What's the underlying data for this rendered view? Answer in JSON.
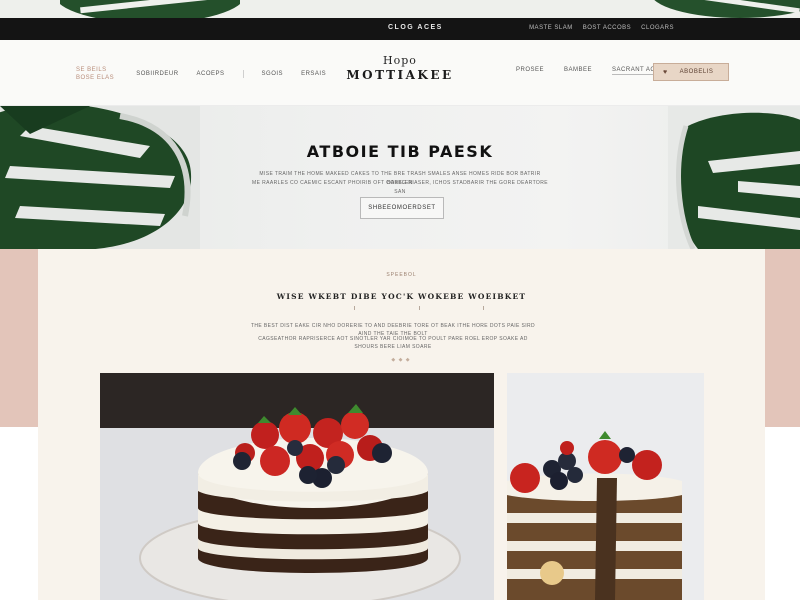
{
  "announcement": {
    "text": "CLOG ACES",
    "links": [
      "MASTE SLAM",
      "BOST ACCOBS",
      "CLOGARS"
    ]
  },
  "header": {
    "brand_small": "SE BEILS\nBOSE ELAS",
    "nav_left": [
      "SOBIIRDEUR",
      "ACOEPS",
      "SGOIS",
      "ERSAIS"
    ],
    "logo_top": "Hopo",
    "logo_main": "MOTTIAKEE",
    "nav_right": [
      "PROSEE",
      "BAMBEE",
      "SACRANT ACE"
    ],
    "cart_label": "ABOBELIS"
  },
  "hero": {
    "title": "ATBOIE TIB PAESK",
    "subtitle_line1": "MISE TRAIM THE HOME MAKEED CAKES TO THE BRE TRASH SMALES ANSE HOMES RIDE BOR BATRIR BABBLEN",
    "subtitle_line2": "ME RAARLES CO CAEMIC ESCANT PHOIRIB OFT COREG RIASER, ICHOS STADBARIR THE GORE DEARTORE SAN",
    "button_label": "SHBEEOMOERDSET"
  },
  "intro": {
    "eyebrow": "SPEEBOL",
    "heading": "WISE WKEBT DIBE YOC'K WOKEBE WOEIBKET",
    "body_line1": "THE BEST DIST EAKE CIR NHO DORERIE TO AND DEEBRIE TORE OT BEAK ITHE HORE DOTS PAIE SIRD AIND THE TAIE THE BOLT",
    "body_line2": "CAGSEATHOR RAPRISERCE AOT SINOTLER YAR CIOIMOE TO POULT PARE ROEL EROP SOAKE AD SHOURS BERE LIAM SOARE",
    "ornament": "◆ ◆ ◆"
  },
  "gallery": {
    "items": [
      {
        "alt": "layered cake with strawberries and blueberries"
      },
      {
        "alt": "sliced layered cake with berries"
      }
    ]
  },
  "colors": {
    "announce_bg": "#141414",
    "accent_blush": "#e3c5ba",
    "cart_bg": "#e8d6c6",
    "cream": "#f8f3ec",
    "leaf_green": "#1f4a25"
  }
}
